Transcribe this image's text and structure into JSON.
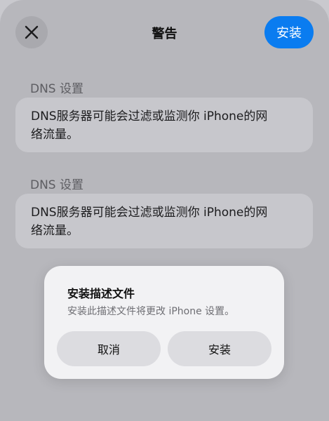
{
  "header": {
    "title": "警告",
    "install_label": "安装"
  },
  "sections": [
    {
      "label": "DNS 设置",
      "text": "DNS服务器可能会过滤或监测你 iPhone的网络流量。"
    },
    {
      "label": "DNS 设置",
      "text": "DNS服务器可能会过滤或监测你 iPhone的网络流量。"
    }
  ],
  "dialog": {
    "title": "安装描述文件",
    "message": "安装此描述文件将更改 iPhone 设置。",
    "cancel_label": "取消",
    "install_label": "安装"
  },
  "colors": {
    "accent": "#0a7cf0",
    "sheet_background": "#b7b7bc",
    "card_background": "#c7c7cc",
    "dialog_background": "#f2f2f4"
  },
  "icons": {
    "close": "close-icon"
  }
}
